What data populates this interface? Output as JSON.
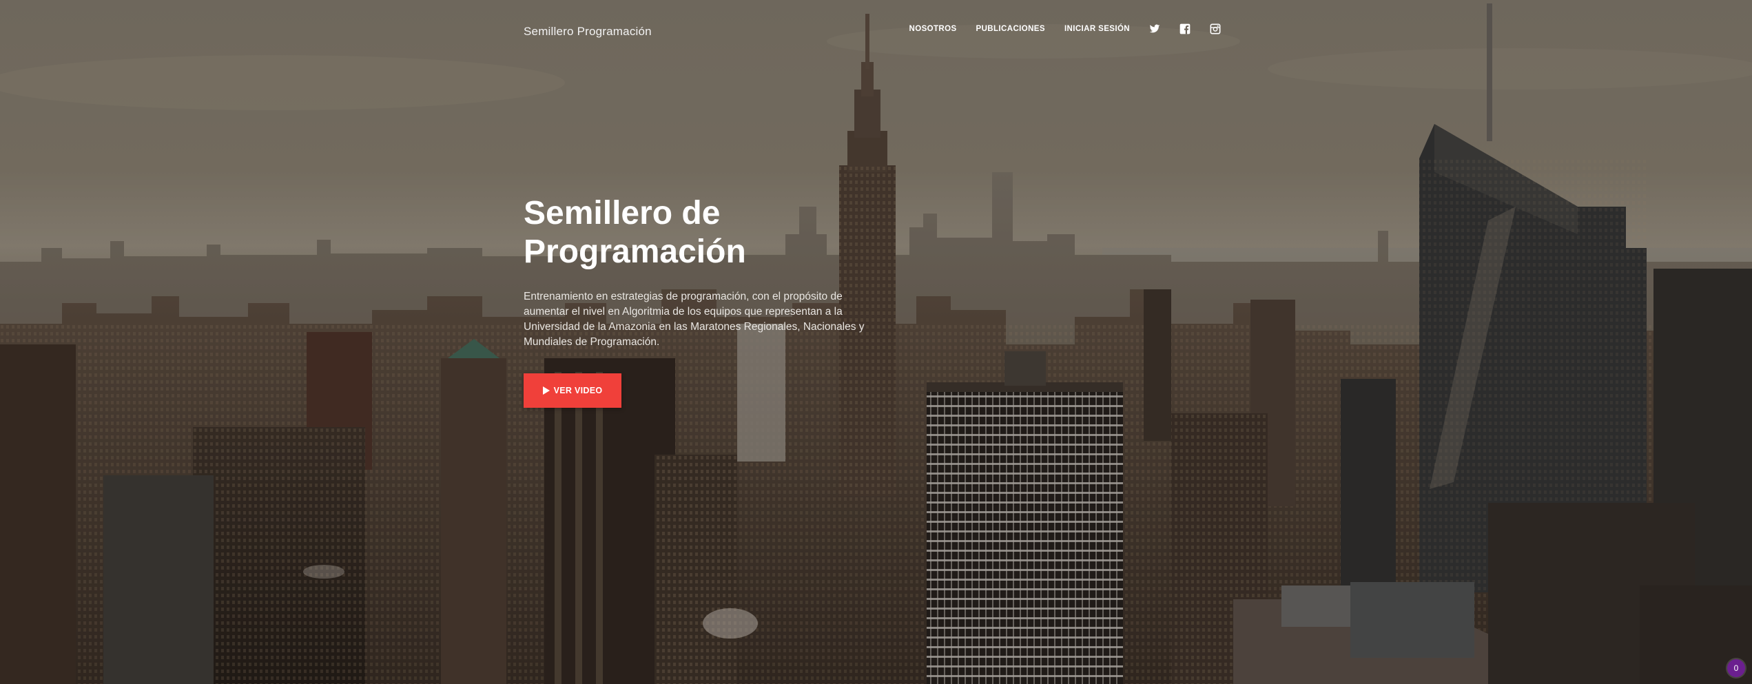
{
  "navbar": {
    "brand": "Semillero Programación",
    "links": [
      "NOSOTROS",
      "PUBLICACIONES",
      "INICIAR SESIÓN"
    ],
    "social_icons": [
      "twitter-icon",
      "facebook-icon",
      "instagram-icon"
    ]
  },
  "hero": {
    "title_line1": "Semillero de",
    "title_line2": "Programación",
    "description": "Entrenamiento en estrategias de programación, con el propósito de aumentar el nivel en Algoritmia de los equipos que representan a la Universidad de la Amazonia en las Maratones Regionales, Nacionales y Mundiales de Programación.",
    "button_label": "VER VIDEO",
    "button_icon": "play-icon"
  },
  "corner_badge": {
    "count": "0"
  },
  "colors": {
    "accent": "#f0403a",
    "badge": "#6b1f8f",
    "text": "#ffffff"
  }
}
